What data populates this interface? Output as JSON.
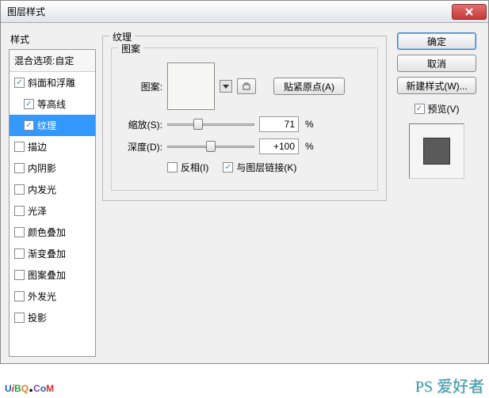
{
  "window": {
    "title": "图层样式"
  },
  "leftPanel": {
    "label": "样式",
    "header": "混合选项:自定",
    "items": [
      {
        "label": "斜面和浮雕",
        "checked": true,
        "indent": false,
        "selected": false
      },
      {
        "label": "等高线",
        "checked": true,
        "indent": true,
        "selected": false
      },
      {
        "label": "纹理",
        "checked": true,
        "indent": true,
        "selected": true
      },
      {
        "label": "描边",
        "checked": false,
        "indent": false,
        "selected": false
      },
      {
        "label": "内阴影",
        "checked": false,
        "indent": false,
        "selected": false
      },
      {
        "label": "内发光",
        "checked": false,
        "indent": false,
        "selected": false
      },
      {
        "label": "光泽",
        "checked": false,
        "indent": false,
        "selected": false
      },
      {
        "label": "颜色叠加",
        "checked": false,
        "indent": false,
        "selected": false
      },
      {
        "label": "渐变叠加",
        "checked": false,
        "indent": false,
        "selected": false
      },
      {
        "label": "图案叠加",
        "checked": false,
        "indent": false,
        "selected": false
      },
      {
        "label": "外发光",
        "checked": false,
        "indent": false,
        "selected": false
      },
      {
        "label": "投影",
        "checked": false,
        "indent": false,
        "selected": false
      }
    ]
  },
  "mid": {
    "groupTitle": "纹理",
    "patternGroup": "图案",
    "patternLabel": "图案:",
    "snapOrigin": "贴紧原点(A)",
    "scaleLabel": "缩放(S):",
    "scaleValue": "71",
    "scaleUnit": "%",
    "scalePos": 35,
    "depthLabel": "深度(D):",
    "depthValue": "+100",
    "depthUnit": "%",
    "depthPos": 50,
    "invertLabel": "反相(I)",
    "invertChecked": false,
    "linkLabel": "与图层链接(K)",
    "linkChecked": true
  },
  "right": {
    "ok": "确定",
    "cancel": "取消",
    "newStyle": "新建样式(W)...",
    "previewLabel": "预览(V)",
    "previewChecked": true
  },
  "watermark": {
    "right": "PS 爱好者"
  }
}
